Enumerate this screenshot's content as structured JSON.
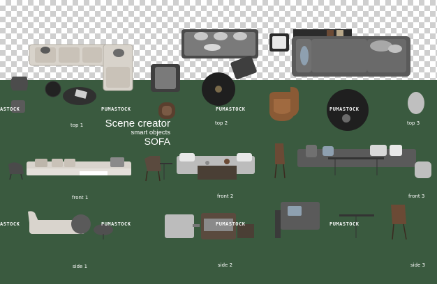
{
  "title": {
    "main": "Scene creator",
    "sub": "smart objects",
    "category": "SOFA"
  },
  "labels": {
    "top1": "top 1",
    "top2": "top 2",
    "top3": "top 3",
    "front1": "front 1",
    "front2": "front 2",
    "front3": "front 3",
    "side1": "side 1",
    "side2": "side 2",
    "side3": "side 3"
  },
  "watermark": {
    "text_a": "PUMASTOCK",
    "text_b": "MASTOCK",
    "text_c": "ASTOCK"
  },
  "colors": {
    "panel": "#3a5a3f",
    "sofa_light": "#d9d4cd",
    "sofa_dark": "#5a5a5a",
    "wood": "#6b4a35",
    "leather": "#8a5a35"
  }
}
